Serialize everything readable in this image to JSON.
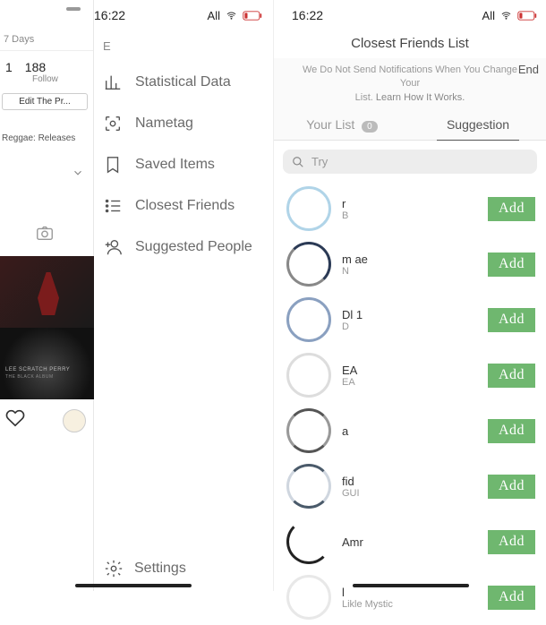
{
  "status": {
    "time": "16:22",
    "net": "All"
  },
  "profile": {
    "days": "7 Days",
    "n1": "1",
    "n2": "188",
    "follow": "Follow",
    "edit": "Edit The Pr...",
    "reggae": "Reggae: Releases",
    "thumb2_line1": "LEE SCRATCH PERRY",
    "thumb2_line2": "THE BLACK ALBUM"
  },
  "menu": {
    "e": "E",
    "items": [
      {
        "label": "Statistical Data"
      },
      {
        "label": "Nametag"
      },
      {
        "label": "Saved Items"
      },
      {
        "label": "Closest Friends"
      },
      {
        "label": "Suggested People"
      }
    ],
    "settings": "Settings"
  },
  "right": {
    "title": "Closest Friends List",
    "end": "End",
    "notice_l1": "We Do Not Send Notifications When You Change Your",
    "notice_l2": "List.",
    "notice_link": "Learn How It Works.",
    "tabs": {
      "your": "Your List",
      "badge": "0",
      "sugg": "Suggestion"
    },
    "search_placeholder": "Try",
    "add": "Add",
    "rows": [
      {
        "u": "r",
        "s": "B"
      },
      {
        "u": "m          ae",
        "s": "N"
      },
      {
        "u": "Dl        1",
        "s": "D"
      },
      {
        "u": "EA",
        "s": "EA"
      },
      {
        "u": "a",
        "s": " "
      },
      {
        "u": "fid",
        "s": "GUI"
      },
      {
        "u": "Amr",
        "s": " "
      },
      {
        "u": "l",
        "s": "Likle Mystic"
      }
    ]
  }
}
